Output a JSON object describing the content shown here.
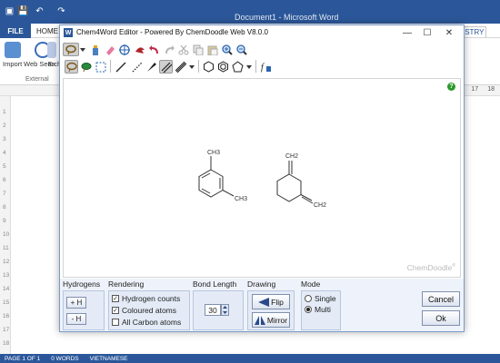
{
  "word": {
    "title": "Document1 - Microsoft Word",
    "tabs": {
      "file": "FILE",
      "home": "HOME",
      "chemistry": "ISTRY"
    },
    "ribbon": {
      "import": "Import",
      "web_search": "Web Search",
      "external": "External",
      "ex": "Ex"
    },
    "ruler_numbers": [
      "17",
      "18"
    ],
    "left_ruler_numbers": [
      "1",
      "2",
      "3",
      "4",
      "5",
      "6",
      "7",
      "8",
      "9",
      "10",
      "11",
      "12",
      "13",
      "14",
      "15",
      "16",
      "17",
      "18"
    ],
    "status": {
      "page": "PAGE 1 OF 1",
      "words": "0 WORDS",
      "language": "VIETNAMESE"
    }
  },
  "dialog": {
    "title": "Chem4Word Editor - Powered By ChemDoodle Web V8.0.0",
    "app_icon": "W",
    "controls": {
      "minimize": "—",
      "maximize": "☐",
      "close": "✕"
    },
    "watermark": "ChemDoodle",
    "watermark_mark": "®",
    "help": "?",
    "molecule_labels": {
      "m1_top": "CH3",
      "m1_side": "CH3",
      "m2_top": "CH2",
      "m2_side": "CH2"
    },
    "icons": [
      "lasso-icon",
      "dropdown-icon",
      "bottle-icon",
      "eraser-icon",
      "center-icon",
      "flip-icon",
      "undo-icon",
      "redo-icon",
      "cut-icon",
      "copy-icon",
      "paste-icon",
      "zoom-in-icon",
      "zoom-out-icon",
      "lasso-select-icon",
      "lasso-shape-icon",
      "rect-select-icon",
      "single-bond-icon",
      "dashed-bond-icon",
      "wedge-bond-icon",
      "double-bond-icon",
      "triple-bond-icon",
      "bond-dropdown-icon",
      "benzene-icon",
      "cyclohexane-icon",
      "pentagon-icon",
      "ring-dropdown-icon",
      "formula-icon"
    ]
  },
  "panel": {
    "hydrogens": {
      "title": "Hydrogens",
      "add": "+ H",
      "remove": "- H"
    },
    "rendering": {
      "title": "Rendering",
      "options": [
        {
          "label": "Hydrogen counts",
          "checked": true
        },
        {
          "label": "Coloured atoms",
          "checked": true
        },
        {
          "label": "All Carbon atoms",
          "checked": false
        }
      ]
    },
    "bond_length": {
      "title": "Bond Length",
      "value": "30"
    },
    "drawing": {
      "title": "Drawing",
      "flip": "Flip",
      "mirror": "Mirror"
    },
    "mode": {
      "title": "Mode",
      "single": "Single",
      "multi": "Multi",
      "selected": "Multi"
    },
    "cancel": "Cancel",
    "ok": "Ok"
  },
  "colors": {
    "word_blue": "#2b579a",
    "panel_bg": "#eef2fa",
    "help_green": "#2a9a2a"
  }
}
